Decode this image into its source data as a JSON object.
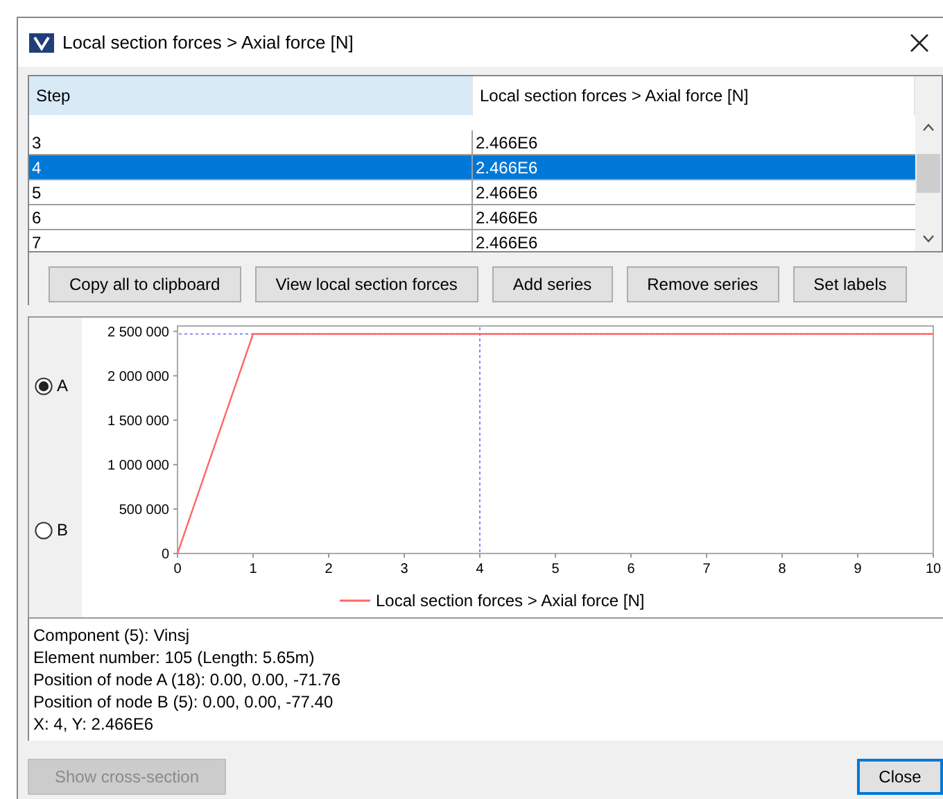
{
  "window": {
    "title": "Local section forces > Axial force [N]"
  },
  "table": {
    "columns": [
      "Step",
      "Local section forces > Axial force [N]"
    ],
    "rows": [
      {
        "cells": [
          "3",
          "2.466E6"
        ],
        "selected": false
      },
      {
        "cells": [
          "4",
          "2.466E6"
        ],
        "selected": true
      },
      {
        "cells": [
          "5",
          "2.466E6"
        ],
        "selected": false
      },
      {
        "cells": [
          "6",
          "2.466E6"
        ],
        "selected": false
      },
      {
        "cells": [
          "7",
          "2.466E6"
        ],
        "selected": false
      }
    ]
  },
  "toolbar": [
    "Copy all to clipboard",
    "View local section forces",
    "Add series",
    "Remove series",
    "Set labels"
  ],
  "nodes": [
    {
      "label": "A",
      "selected": true
    },
    {
      "label": "B",
      "selected": false
    }
  ],
  "chart": {
    "chart_data": {
      "type": "line",
      "x": [
        0,
        1,
        2,
        3,
        4,
        5,
        6,
        7,
        8,
        9,
        10
      ],
      "xlim": [
        0,
        10
      ],
      "ylim": [
        0,
        2560000
      ],
      "xticks": [
        0,
        1,
        2,
        3,
        4,
        5,
        6,
        7,
        8,
        9,
        10
      ],
      "yticks": [
        {
          "value": 0,
          "label": "0"
        },
        {
          "value": 500000,
          "label": "500 000"
        },
        {
          "value": 1000000,
          "label": "1 000 000"
        },
        {
          "value": 1500000,
          "label": "1 500 000"
        },
        {
          "value": 2000000,
          "label": "2 000 000"
        },
        {
          "value": 2500000,
          "label": "2 500 000"
        }
      ],
      "series": [
        {
          "name": "Local section forces > Axial force [N]",
          "color": "#ff6666",
          "values": [
            0,
            2470000,
            2470000,
            2470000,
            2470000,
            2470000,
            2470000,
            2470000,
            2470000,
            2470000,
            2470000
          ]
        }
      ],
      "ref_lines": [
        {
          "axis": "x",
          "value": 4
        },
        {
          "axis": "y",
          "value": 2470000
        }
      ]
    }
  },
  "info": [
    "Component (5): Vinsj",
    "Element number: 105 (Length: 5.65m)",
    "Position of node A (18): 0.00, 0.00, -71.76",
    "Position of node B (5): 0.00, 0.00, -77.40",
    "X: 4, Y: 2.466E6"
  ],
  "buttons": [
    {
      "label": "Show cross-section",
      "disabled": true
    },
    {
      "label": "Close",
      "disabled": false
    }
  ]
}
